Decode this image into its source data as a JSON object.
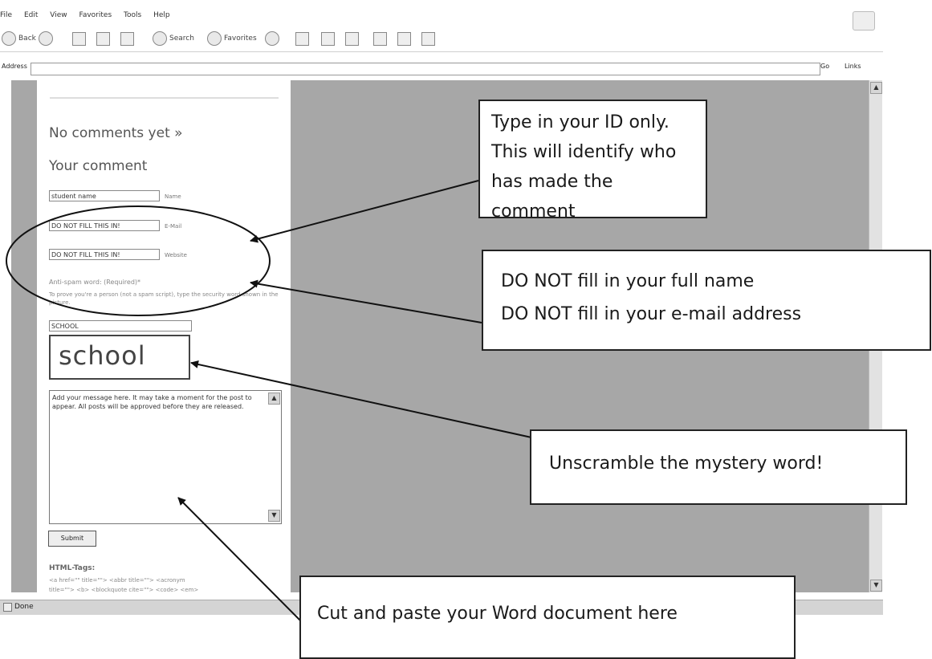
{
  "browser": {
    "menu": [
      "File",
      "Edit",
      "View",
      "Favorites",
      "Tools",
      "Help"
    ],
    "toolbar": {
      "back": "Back",
      "search": "Search",
      "favorites": "Favorites"
    },
    "address_label": "Address",
    "go": "Go",
    "links": "Links",
    "status": "Done"
  },
  "blog": {
    "no_comments": "No comments yet »",
    "your_comment": "Your comment",
    "name_value": "student name",
    "name_label": "Name",
    "email_value": "DO NOT FILL THIS IN!",
    "email_label": "E-Mail",
    "website_value": "DO NOT FILL THIS IN!",
    "website_label": "Website",
    "antispam_title": "Anti-spam word: (Required)*",
    "antispam_help": "To prove you're a person (not a spam script), type the security word shown in the picture.",
    "antispam_value": "SCHOOL",
    "captcha_word": "school",
    "message": "Add your message here. It may take a moment for the post to appear. All posts will be approved before they are released.",
    "submit": "Submit",
    "html_tags_title": "HTML-Tags:",
    "html_tags_line1": "<a href=\"\" title=\"\"> <abbr title=\"\"> <acronym",
    "html_tags_line2": "title=\"\"> <b> <blockquote cite=\"\"> <code> <em>"
  },
  "callouts": {
    "id": "Type in your ID only.  This will identify who has made the comment",
    "dont_name": "DO NOT fill in your full name",
    "dont_email": "DO NOT fill in your e-mail address",
    "mystery": "Unscramble the mystery word!",
    "paste": "Cut and paste your Word document here"
  }
}
